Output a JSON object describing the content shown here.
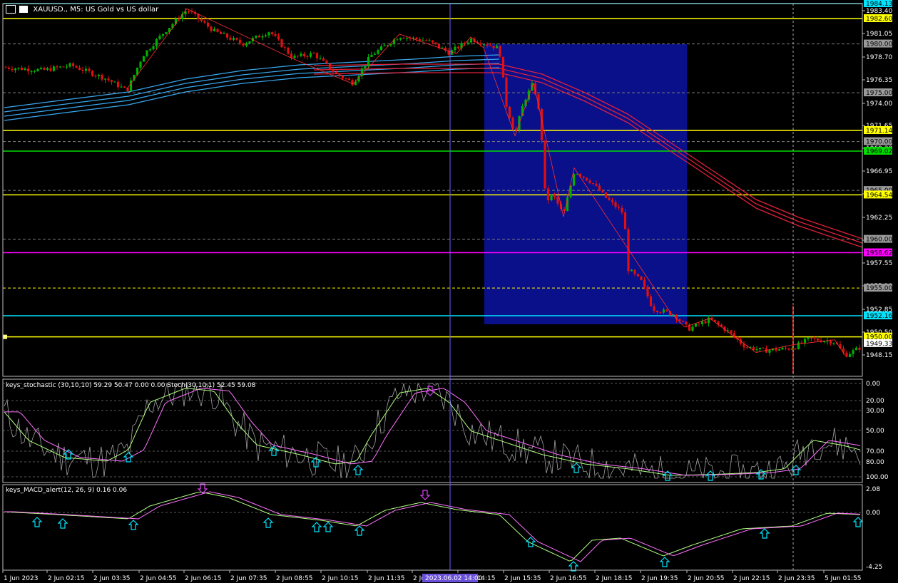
{
  "header": {
    "symbol_title": "XAUUSD., M5:  US Gold vs US dollar"
  },
  "stoch_header": "keys_stochastic (30,10,10) 59.29 50.47 0.00 0.00 Stoch(30,10,1) 52.45 59.08",
  "macd_header": "keys_MACD_alert(12, 26, 9) 0.16 0.06",
  "price_axis": {
    "ticks": [
      "1983.40",
      "1981.05",
      "1978.70",
      "1976.35",
      "1974.00",
      "1971.65",
      "1969.30",
      "1966.95",
      "1964.60",
      "1962.25",
      "1959.90",
      "1957.55",
      "1955.20",
      "1952.85",
      "1950.50",
      "1948.15"
    ],
    "ticks_y": [
      15,
      47,
      80,
      112,
      145,
      176,
      208,
      240,
      272,
      305,
      337,
      369,
      401,
      434,
      466,
      498
    ]
  },
  "hlines": [
    {
      "label": "1984.13",
      "color": "#00e5ff",
      "style": "solid",
      "text": "#000000"
    },
    {
      "label": "1982.60",
      "color": "#ffff00",
      "style": "solid",
      "text": "#000000"
    },
    {
      "label": "1980.00",
      "color": "#808080",
      "style": "dash",
      "text": "#000000"
    },
    {
      "label": "1975.00",
      "color": "#808080",
      "style": "dash",
      "text": "#000000"
    },
    {
      "label": "1971.14",
      "color": "#ffff00",
      "style": "solid",
      "text": "#000000"
    },
    {
      "label": "1970.00",
      "color": "#808080",
      "style": "dash",
      "text": "#000000"
    },
    {
      "label": "1969.02",
      "color": "#00e000",
      "style": "solid",
      "text": "#000000"
    },
    {
      "label": "1965.00",
      "color": "#808080",
      "style": "dash",
      "text": "#000000"
    },
    {
      "label": "1964.54",
      "color": "#ffff00",
      "style": "solid",
      "text": "#000000"
    },
    {
      "label": "1960.00",
      "color": "#808080",
      "style": "dash",
      "text": "#000000"
    },
    {
      "label": "1958.62",
      "color": "#ff00ff",
      "style": "solid",
      "text": "#000000"
    },
    {
      "label": "1955.00",
      "color": "#ffff00",
      "style": "dash",
      "text": "#000000"
    },
    {
      "label": "1952.16",
      "color": "#00e5ff",
      "style": "solid",
      "text": "#000000"
    },
    {
      "label": "1950.00",
      "color": "#ffff00",
      "style": "solid",
      "text": "#000000"
    },
    {
      "label": "1949.33",
      "color": "#ffffff",
      "style": "none",
      "text": "#000000"
    }
  ],
  "stoch_axis": [
    "100.00",
    "80.00",
    "70.00",
    "50.00",
    "30.00",
    "20.00",
    "0.00"
  ],
  "macd_axis": [
    "2.08",
    "0.00",
    "-4.25"
  ],
  "time_axis": [
    "1 Jun 2023",
    "2 Jun 02:15",
    "2 Jun 03:35",
    "2 Jun 04:55",
    "2 Jun 06:15",
    "2 Jun 07:35",
    "2 Jun 08:55",
    "2 Jun 10:15",
    "2 Jun 11:35",
    "2 Jun 12:55",
    "2 Jun 14:15",
    "2 Jun 15:35",
    "2 Jun 16:55",
    "2 Jun 18:15",
    "2 Jun 19:35",
    "2 Jun 20:55",
    "2 Jun 22:15",
    "2 Jun 23:35",
    "5 Jun 01:55"
  ],
  "crosshair_time": "2023.06.02 14:00",
  "colors": {
    "bull": "#00b000",
    "bear": "#e01010",
    "ma_red": "#e0203a",
    "ma_blue": "#39a8f0",
    "zone": "#0a0f8a",
    "stoch_main": "#b0ff80",
    "stoch_sig": "#ff70ff",
    "stoch_raw": "#a0a0a0",
    "macd_main": "#b0ff80",
    "macd_sig": "#ff70ff",
    "up_arrow": "#00e5ff",
    "down_arrow": "#e040fb"
  }
}
